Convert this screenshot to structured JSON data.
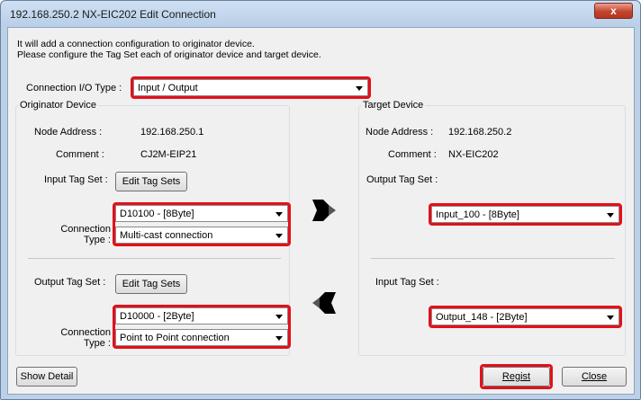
{
  "window": {
    "title": "192.168.250.2 NX-EIC202 Edit Connection",
    "close_glyph": "x"
  },
  "intro": {
    "line1": "It will add a connection configuration to originator device.",
    "line2": "Please configure the Tag Set each of originator device and target device."
  },
  "io_type": {
    "label": "Connection I/O Type :",
    "value": "Input / Output"
  },
  "originator": {
    "title": "Originator Device",
    "node_label": "Node Address :",
    "node_value": "192.168.250.1",
    "comment_label": "Comment :",
    "comment_value": "CJ2M-EIP21",
    "input_tag_label": "Input Tag Set :",
    "input_edit_label": "Edit Tag Sets",
    "input_tag_value": "D10100 - [8Byte]",
    "conn_type_label": "Connection Type :",
    "input_conn_type_value": "Multi-cast connection",
    "output_tag_label": "Output Tag Set :",
    "output_edit_label": "Edit Tag Sets",
    "output_tag_value": "D10000 - [2Byte]",
    "output_conn_type_value": "Point to Point connection"
  },
  "target": {
    "title": "Target Device",
    "node_label": "Node Address :",
    "node_value": "192.168.250.2",
    "comment_label": "Comment :",
    "comment_value": "NX-EIC202",
    "output_tag_label": "Output Tag Set :",
    "output_tag_value": "Input_100 - [8Byte]",
    "input_tag_label": "Input Tag Set :",
    "input_tag_value": "Output_148 - [2Byte]"
  },
  "footer": {
    "show_detail": "Show Detail",
    "regist": "Regist",
    "close": "Close"
  },
  "icons": {
    "arrow_right": "arrow-right-icon",
    "arrow_left": "arrow-left-icon"
  },
  "colors": {
    "highlight": "#e3101a",
    "titlebar": "#bcd0e8"
  }
}
